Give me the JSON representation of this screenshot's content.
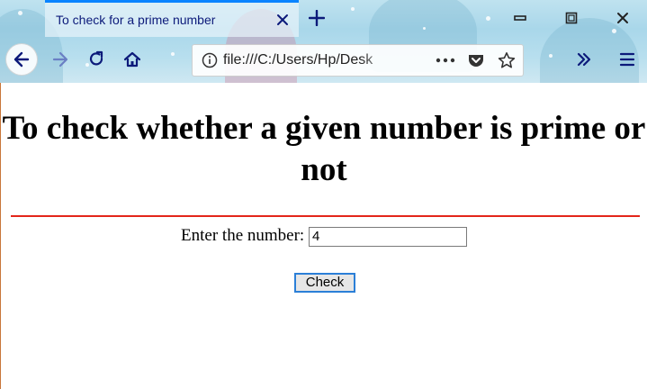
{
  "browser": {
    "tab_title": "To check for a prime number",
    "url": "file:///C:/Users/Hp/Desk",
    "accent": "#0a84ff"
  },
  "icons": {
    "close_tab": "close-icon",
    "new_tab": "plus-icon",
    "minimize": "minimize-icon",
    "maximize": "maximize-icon",
    "close_window": "close-window-icon",
    "back": "back-arrow-icon",
    "forward": "forward-arrow-icon",
    "reload": "reload-icon",
    "home": "home-icon",
    "site_info": "info-icon",
    "page_actions": "more-icon",
    "pocket": "pocket-icon",
    "bookmark": "star-icon",
    "overflow": "chevrons-right-icon",
    "menu": "hamburger-icon"
  },
  "page": {
    "heading": "To check whether a given number is prime or not",
    "rule_color": "#e3261a",
    "form": {
      "label": "Enter the number:",
      "input_value": "4",
      "button_label": "Check"
    }
  }
}
